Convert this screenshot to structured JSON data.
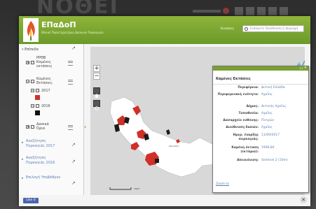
{
  "background": {
    "logo_text": "ΝΟΘΕΙ"
  },
  "header": {
    "title": "ΕΠαΔοΠ",
    "subtitle": "Εθνικό Παρατηρητήριο Δασικών Πυρκαγιών",
    "search_label": "Κινήσεις",
    "search_placeholder": "Εισαγετε διεύθυνση ή περιοχή"
  },
  "sidebar": {
    "layers_heading": "Επίπεδα",
    "layers": [
      {
        "label_lines": [
          "ΡΡΘΒ",
          "Καμένες",
          "εκτάσεις"
        ]
      },
      {
        "label_lines": [
          "Καμένες",
          "Εκτάσεις"
        ]
      },
      {
        "label_lines": [
          "2017"
        ]
      },
      {
        "label_lines": [
          "2016"
        ]
      },
      {
        "label_lines": [
          "Δασικά",
          "Όρια"
        ]
      }
    ],
    "links": [
      {
        "lines": [
          "Αναζήτηση",
          "Πυρκαγιάς 2017"
        ]
      },
      {
        "lines": [
          "Αναζήτηση",
          "Πυρκαγιάς 2016"
        ]
      },
      {
        "lines": [
          "Επιλογή Υποβάθρου"
        ]
      }
    ]
  },
  "map": {
    "place_label": "Ζάκυνθος",
    "scale_label": "10km",
    "attribution": "esri"
  },
  "popup": {
    "title": "Καμένες Εκτάσεις",
    "rows": [
      {
        "key": "Περιφέρεια:",
        "value": "Δυτική Ελλάδα"
      },
      {
        "key": "Περιφερειακή ενότητα:",
        "value": "Αχαΐας"
      },
      {
        "key": "Δήμος:",
        "value": "Δυτικής Αχαΐας"
      },
      {
        "key": "Τοποθεσία:",
        "value": "Αχαΐας"
      },
      {
        "key": "Δασαρχείο ευθύνης:",
        "value": "Πατρών"
      },
      {
        "key": "Διεύθυνση δασών:",
        "value": "Αχαΐας"
      },
      {
        "key": "Ημερ. έναρξης πυρκαγιάς:",
        "value": "11/09/2017"
      },
      {
        "key": "Καμένη έκταση (εκτάρια):",
        "value": "1906,84"
      },
      {
        "key": "Απεικόνιση:",
        "value": "Sentinel 2 (10m)"
      }
    ],
    "zoom_link": "Zoom to"
  },
  "footer": {
    "like_label": "Like 0"
  },
  "colors": {
    "accent": "#7aa030",
    "burned": "#d0302a",
    "land": "#ffffff",
    "sea": "#d8d8d8"
  }
}
